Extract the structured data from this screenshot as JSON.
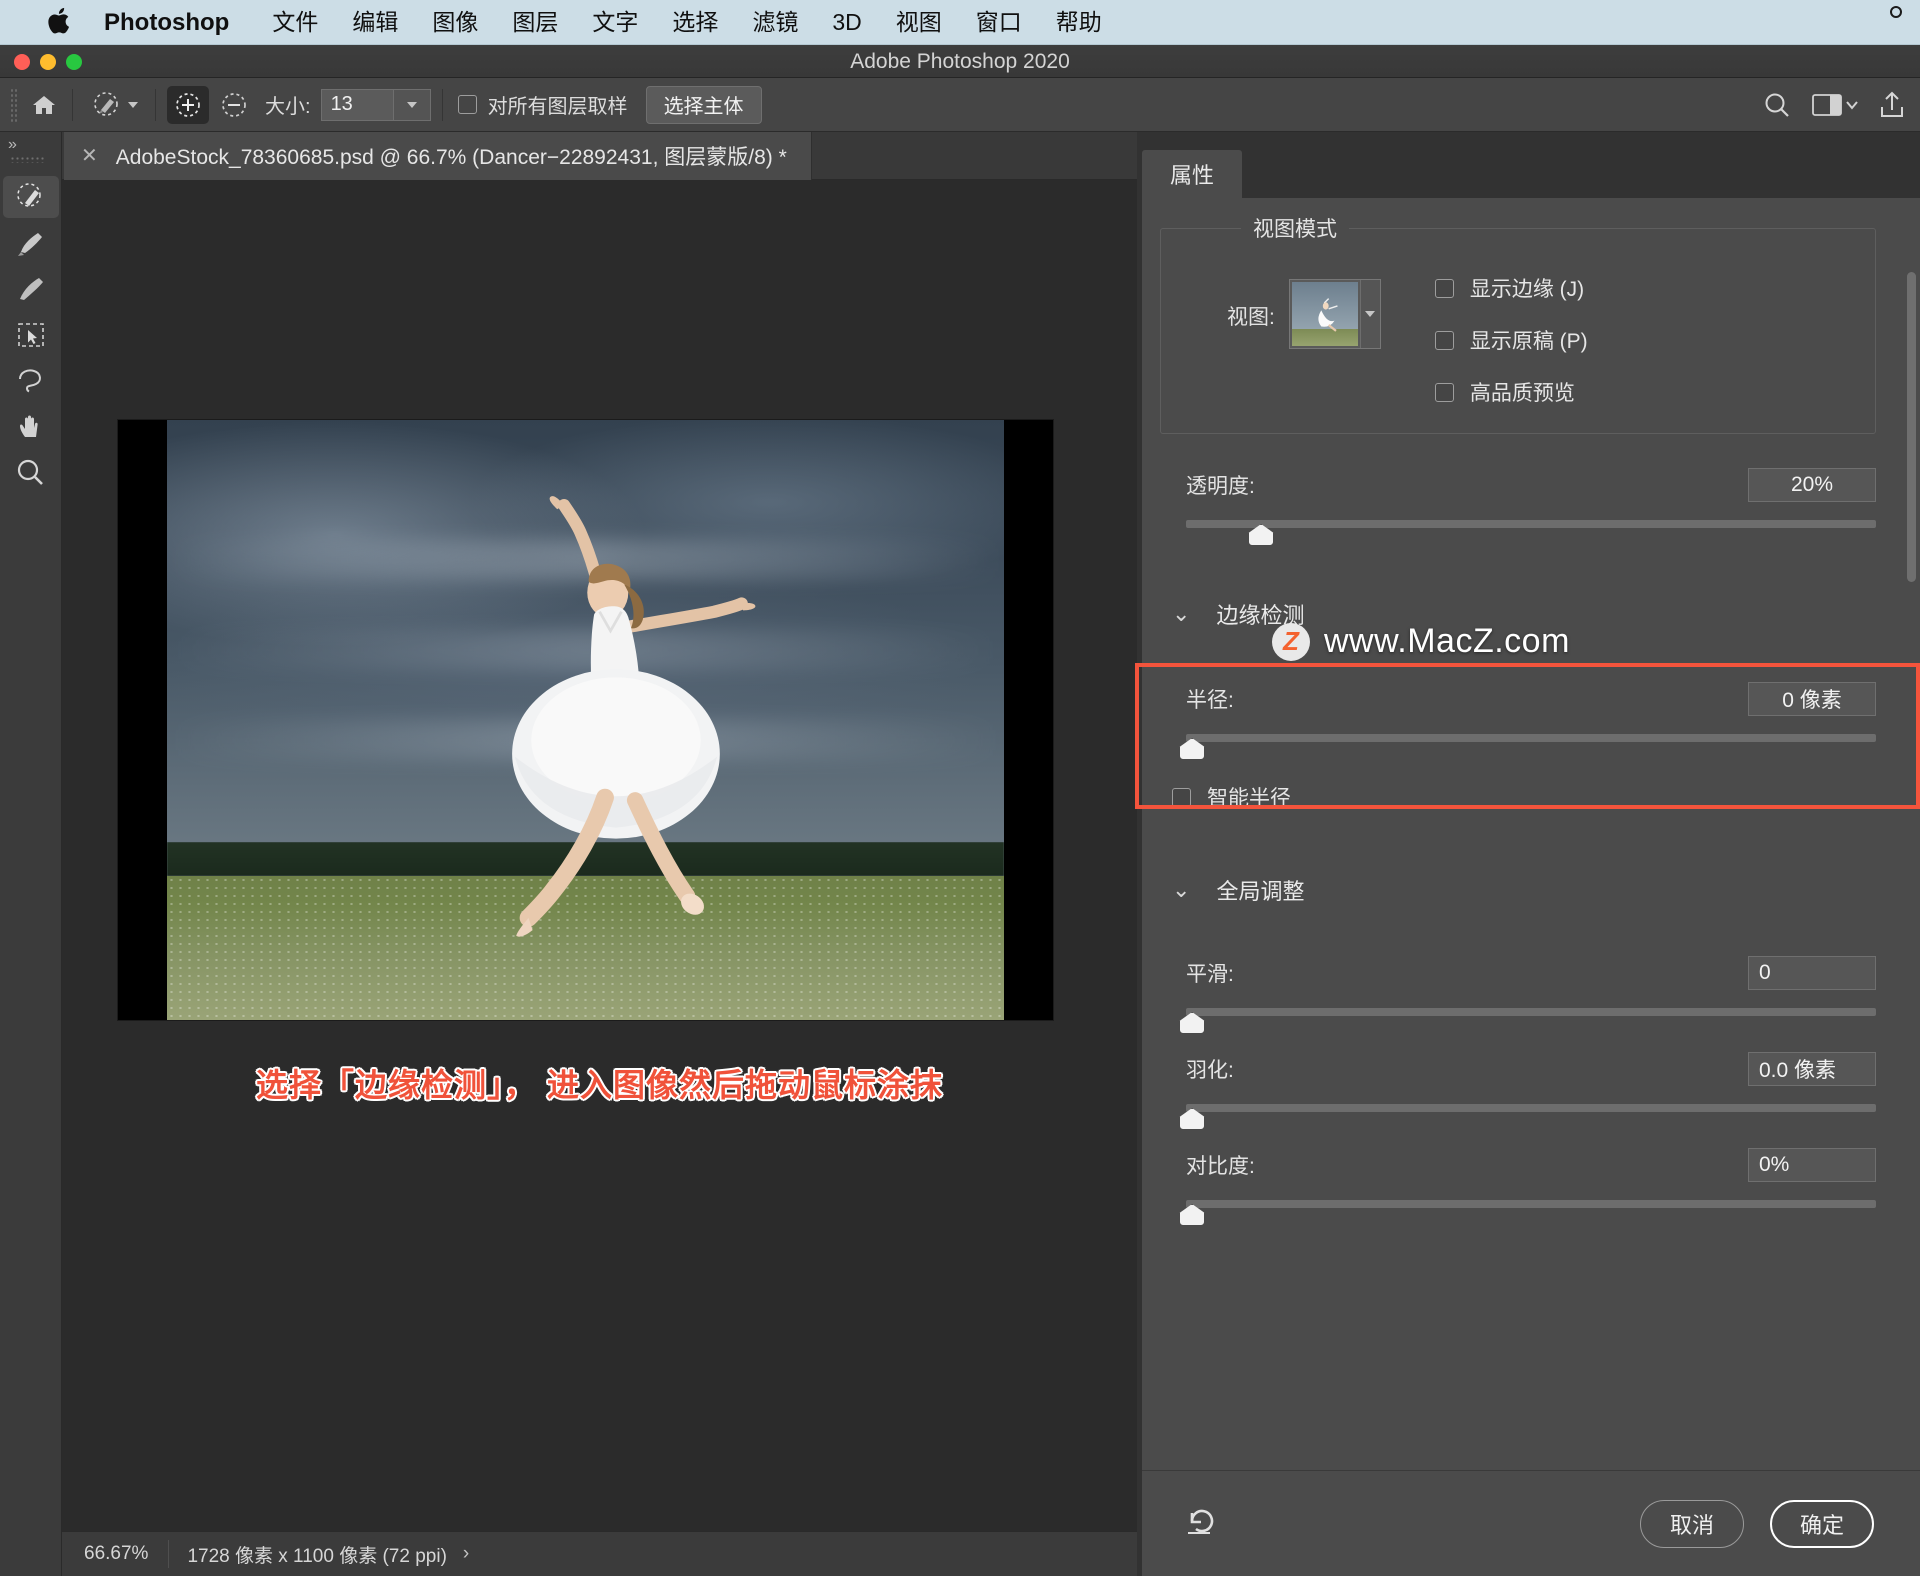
{
  "macmenu": {
    "apple_icon": "apple-logo-icon",
    "brand": "Photoshop",
    "items": [
      "文件",
      "编辑",
      "图像",
      "图层",
      "文字",
      "选择",
      "滤镜",
      "3D",
      "视图",
      "窗口",
      "帮助"
    ]
  },
  "window": {
    "title": "Adobe Photoshop 2020"
  },
  "options_bar": {
    "home_icon": "home-icon",
    "tool_preset_icon": "quick-selection-brush-icon",
    "add_mode_icon": "add-to-selection-icon",
    "subtract_mode_icon": "subtract-from-selection-icon",
    "size_label": "大小:",
    "size_value": "13",
    "sample_all_layers_label": "对所有图层取样",
    "select_subject_label": "选择主体",
    "search_icon": "search-icon",
    "workspace_icon": "workspace-switcher-icon",
    "share_icon": "share-icon"
  },
  "toolbar": {
    "expand_icon": "expand-panel-icon",
    "tools": [
      {
        "name": "quick-selection-tool",
        "selected": true
      },
      {
        "name": "brush-tool",
        "selected": false
      },
      {
        "name": "refine-edge-brush-tool",
        "selected": false
      },
      {
        "name": "object-selection-tool",
        "selected": false
      },
      {
        "name": "lasso-tool",
        "selected": false
      },
      {
        "name": "hand-tool",
        "selected": false
      },
      {
        "name": "zoom-tool",
        "selected": false
      }
    ]
  },
  "document": {
    "tab_title": "AdobeStock_78360685.psd @ 66.7% (Dancer−22892431, 图层蒙版/8) *",
    "close_icon": "close-tab-icon",
    "annotation": "选择「边缘检测」， 进入图像然后拖动鼠标涂抹"
  },
  "status_bar": {
    "zoom": "66.67%",
    "dimensions": "1728 像素 x 1100 像素 (72 ppi)",
    "expand_arrow": "›"
  },
  "properties_panel": {
    "tab_label": "属性",
    "view_mode": {
      "legend": "视图模式",
      "view_label": "视图:",
      "thumbnail_icon": "view-mode-thumbnail",
      "dropdown_icon": "chevron-down-icon",
      "checkboxes": [
        {
          "label": "显示边缘 (J)",
          "checked": false
        },
        {
          "label": "显示原稿 (P)",
          "checked": false
        },
        {
          "label": "高品质预览",
          "checked": false
        }
      ]
    },
    "transparency": {
      "label": "透明度:",
      "value": "20%",
      "slider_percent": 20
    },
    "edge_detection": {
      "title": "边缘检测",
      "chevron_icon": "chevron-down-icon",
      "radius_label": "半径:",
      "radius_value": "0 像素",
      "radius_slider_percent": 0,
      "smart_radius_label": "智能半径",
      "smart_radius_checked": false,
      "highlight_color": "#f4543c"
    },
    "global_adjustments": {
      "title": "全局调整",
      "chevron_icon": "chevron-down-icon",
      "sliders": [
        {
          "label": "平滑:",
          "value": "0",
          "percent": 0
        },
        {
          "label": "羽化:",
          "value": "0.0 像素",
          "percent": 0
        },
        {
          "label": "对比度:",
          "value": "0%",
          "percent": 0
        }
      ]
    },
    "footer": {
      "reset_icon": "reset-icon",
      "cancel_label": "取消",
      "ok_label": "确定"
    }
  },
  "watermark": {
    "badge": "Z",
    "text": "www.MacZ.com"
  }
}
